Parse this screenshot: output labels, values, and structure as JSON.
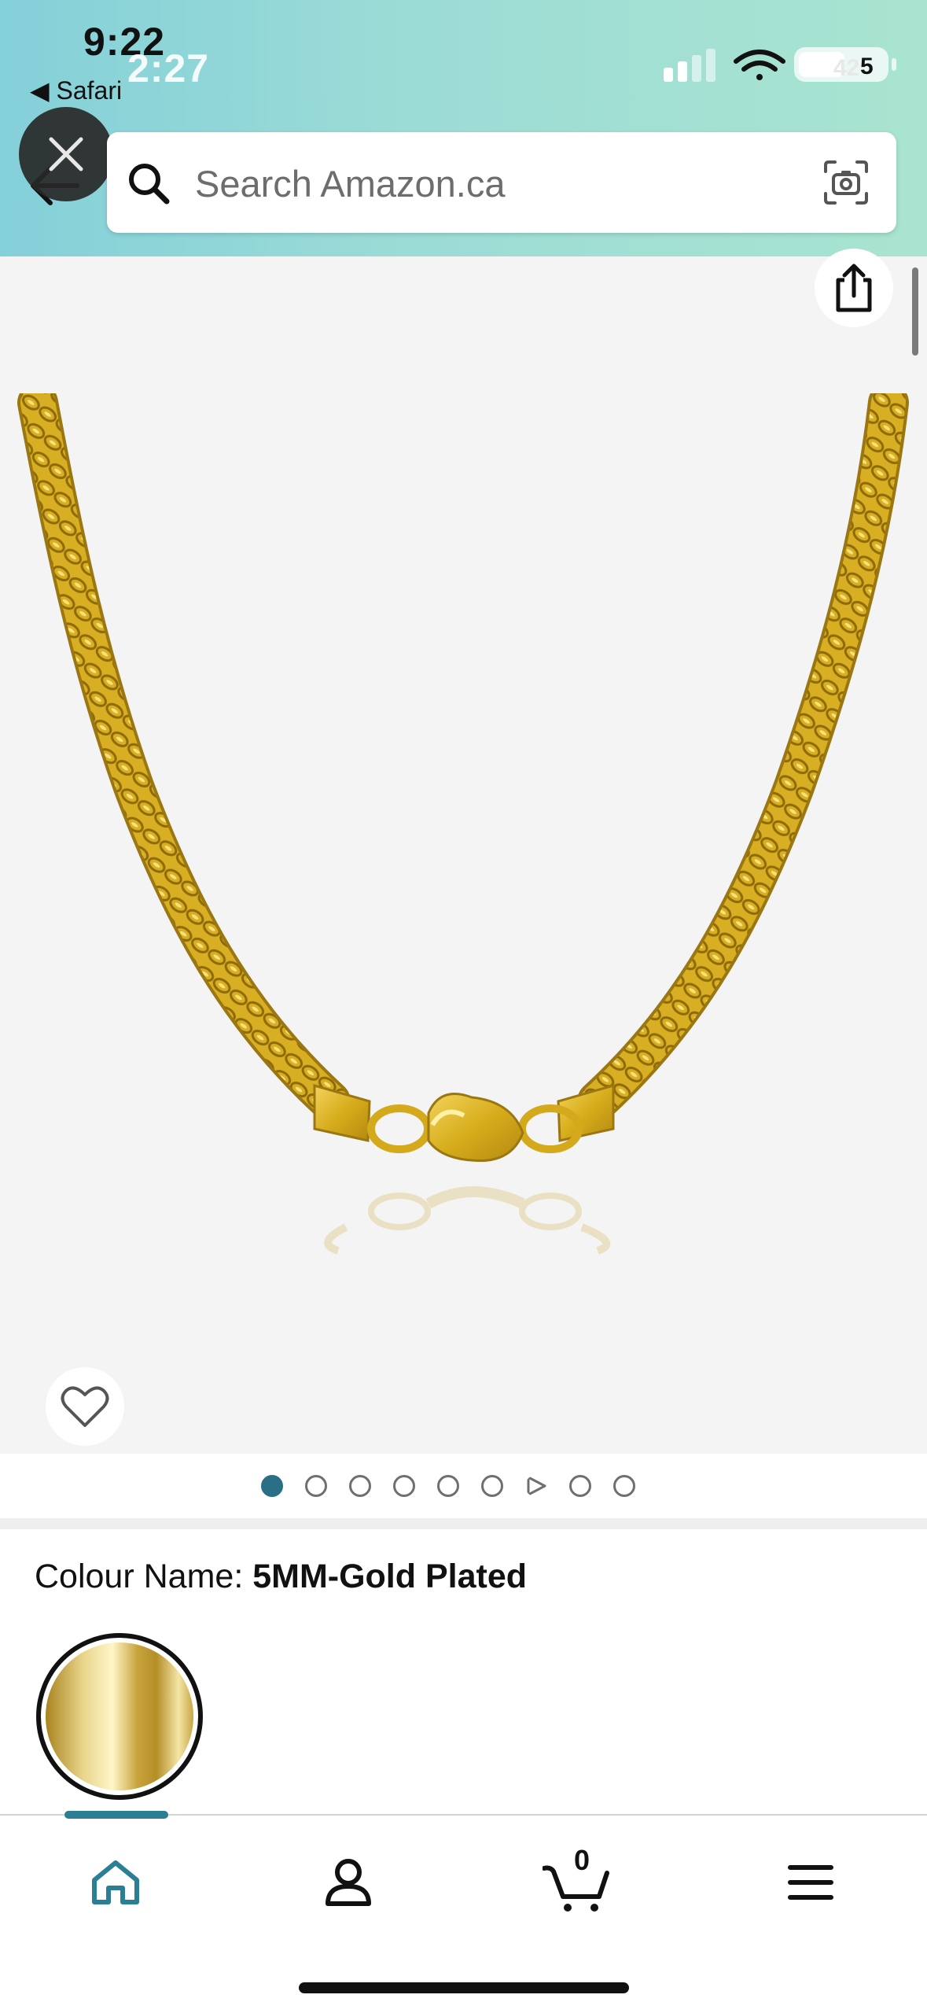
{
  "status_bar": {
    "time": "9:22",
    "time_overlay": "2:27",
    "back_app": "◀ Safari",
    "battery_front": "5",
    "battery_ghost": "42"
  },
  "search": {
    "placeholder": "Search Amazon.ca"
  },
  "gallery": {
    "image_count": 9,
    "active_index": 0,
    "video_index": 6
  },
  "product": {
    "colour_label": "Colour Name: ",
    "colour_value": "5MM-Gold Plated"
  },
  "bottom_nav": {
    "items": [
      "home",
      "account",
      "cart",
      "menu"
    ],
    "active": "home",
    "cart_count": "0"
  },
  "colors": {
    "header_gradient_start": "#84d0d9",
    "header_gradient_end": "#a9e4d0",
    "accent": "#2a7f95",
    "gold": "#d4af2c"
  },
  "icons": [
    "close-icon",
    "back-arrow-icon",
    "search-icon",
    "camera-icon",
    "share-icon",
    "heart-icon",
    "home-icon",
    "account-icon",
    "cart-icon",
    "menu-icon"
  ]
}
